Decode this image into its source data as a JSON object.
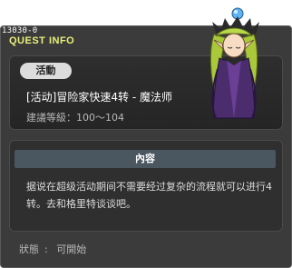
{
  "window": {
    "quest_id": "13030-0",
    "title": "QUEST INFO"
  },
  "quest": {
    "category": "活動",
    "name": "[活动]冒险家快速4转 - 魔法师",
    "level_requirement": "建議等級：100～104"
  },
  "content": {
    "header": "內容",
    "text": "据说在超级活动期间不需要经过复杂的流程就可以进行4转。去和格里特谈谈吧。"
  },
  "status": {
    "label": "狀態",
    "value": "可開始"
  },
  "colors": {
    "title_yellow": "#e9f07a",
    "panel_bg": "#3b3b3b",
    "content_header_bg": "#4a5660"
  },
  "npc": {
    "icon": "npc-sorcerer-portrait"
  }
}
